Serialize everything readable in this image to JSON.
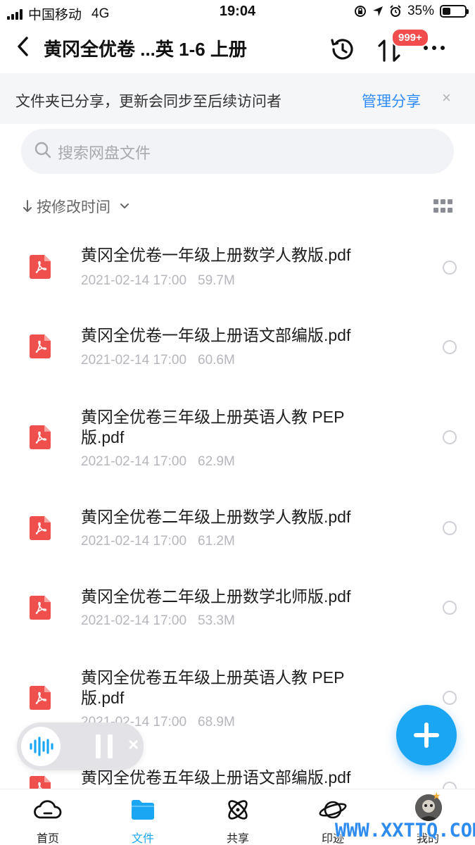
{
  "status_bar": {
    "carrier": "中国移动",
    "network": "4G",
    "time": "19:04",
    "battery": "35%",
    "battery_level": 0.35
  },
  "header": {
    "title": "黄冈全优卷 ...英 1-6 上册",
    "badge": "999+",
    "icons": [
      "chevron-left-icon",
      "history-icon",
      "transfer-icon",
      "more-icon"
    ]
  },
  "share_banner": {
    "text": "文件夹已分享，更新会同步至后续访问者",
    "manage_label": "管理分享",
    "close_label": "×"
  },
  "search": {
    "placeholder": "搜索网盘文件"
  },
  "sort": {
    "label": "按修改时间"
  },
  "files": [
    {
      "name": "黄冈全优卷一年级上册数学人教版.pdf",
      "date": "2021-02-14 17:00",
      "size": "59.7M"
    },
    {
      "name": "黄冈全优卷一年级上册语文部编版.pdf",
      "date": "2021-02-14 17:00",
      "size": "60.6M"
    },
    {
      "name": "黄冈全优卷三年级上册英语人教 PEP 版.pdf",
      "date": "2021-02-14 17:00",
      "size": "62.9M"
    },
    {
      "name": "黄冈全优卷二年级上册数学人教版.pdf",
      "date": "2021-02-14 17:00",
      "size": "61.2M"
    },
    {
      "name": "黄冈全优卷二年级上册数学北师版.pdf",
      "date": "2021-02-14 17:00",
      "size": "53.3M"
    },
    {
      "name": "黄冈全优卷五年级上册英语人教 PEP 版.pdf",
      "date": "2021-02-14 17:00",
      "size": "68.9M"
    },
    {
      "name": "黄冈全优卷五年级上册语文部编版.pdf",
      "date": "",
      "size": ""
    }
  ],
  "tabs": [
    {
      "label": "首页",
      "icon": "cloud-icon"
    },
    {
      "label": "文件",
      "icon": "folder-icon"
    },
    {
      "label": "共享",
      "icon": "orbit-icon"
    },
    {
      "label": "印迹",
      "icon": "planet-icon"
    },
    {
      "label": "我的",
      "icon": "avatar"
    }
  ],
  "watermark": "WWW.XXTTQ.COM",
  "colors": {
    "accent": "#1aa6f3",
    "link": "#2f8cf5",
    "pdf": "#f0504d",
    "badge": "#f24c4c"
  }
}
